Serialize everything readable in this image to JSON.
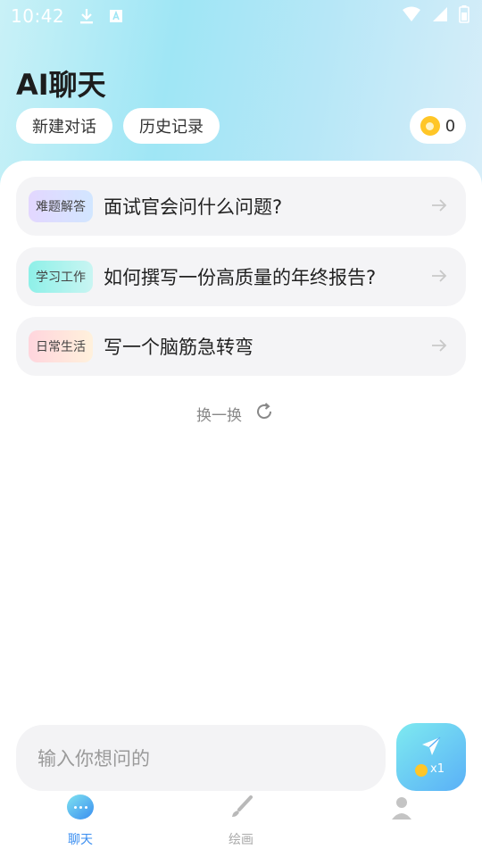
{
  "status_bar": {
    "time": "10:42",
    "icons": [
      "download-icon",
      "text-a-icon",
      "wifi-icon",
      "signal-icon",
      "battery-icon"
    ]
  },
  "header": {
    "title": "AI聊天",
    "new_chat_label": "新建对话",
    "history_label": "历史记录",
    "coin_count": "0"
  },
  "suggestions": [
    {
      "tag": "难题解答",
      "text": "面试官会问什么问题?"
    },
    {
      "tag": "学习工作",
      "text": "如何撰写一份高质量的年终报告?"
    },
    {
      "tag": "日常生活",
      "text": "写一个脑筋急转弯"
    }
  ],
  "refresh_label": "换一换",
  "input": {
    "placeholder": "输入你想问的",
    "send_cost": "x1"
  },
  "bottom_nav": [
    {
      "label": "聊天",
      "icon": "chat-icon",
      "active": true
    },
    {
      "label": "绘画",
      "icon": "brush-icon",
      "active": false
    },
    {
      "label": "",
      "icon": "profile-icon",
      "active": false
    }
  ],
  "colors": {
    "accent": "#3a8ef0",
    "header_gradient_start": "#c9f1f7",
    "header_gradient_end": "#d8eef9",
    "coin": "#ffc627"
  }
}
